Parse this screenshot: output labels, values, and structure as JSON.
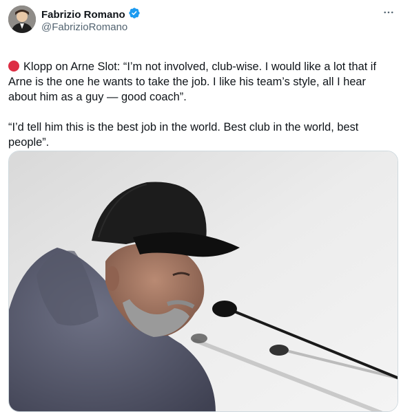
{
  "author": {
    "name": "Fabrizio Romano",
    "handle": "@FabrizioRomano",
    "verified": true
  },
  "tweet": {
    "text": "Klopp on Arne Slot: “I’m not involved, club-wise. I would like a lot that if Arne is the one he wants to take the job. I like his team’s style, all I hear about him as a guy — good coach”.\n\n“I’d tell him this is the best job in the world. Best club in the world, best people”.",
    "leading_emoji": "red-circle"
  },
  "media": {
    "alt": ""
  },
  "colors": {
    "verified_blue": "#1d9bf0",
    "emoji_red": "#dd2e44",
    "secondary_text": "#536471"
  },
  "icons": {
    "more": "more-horizontal-icon",
    "verified": "verified-badge-icon"
  }
}
